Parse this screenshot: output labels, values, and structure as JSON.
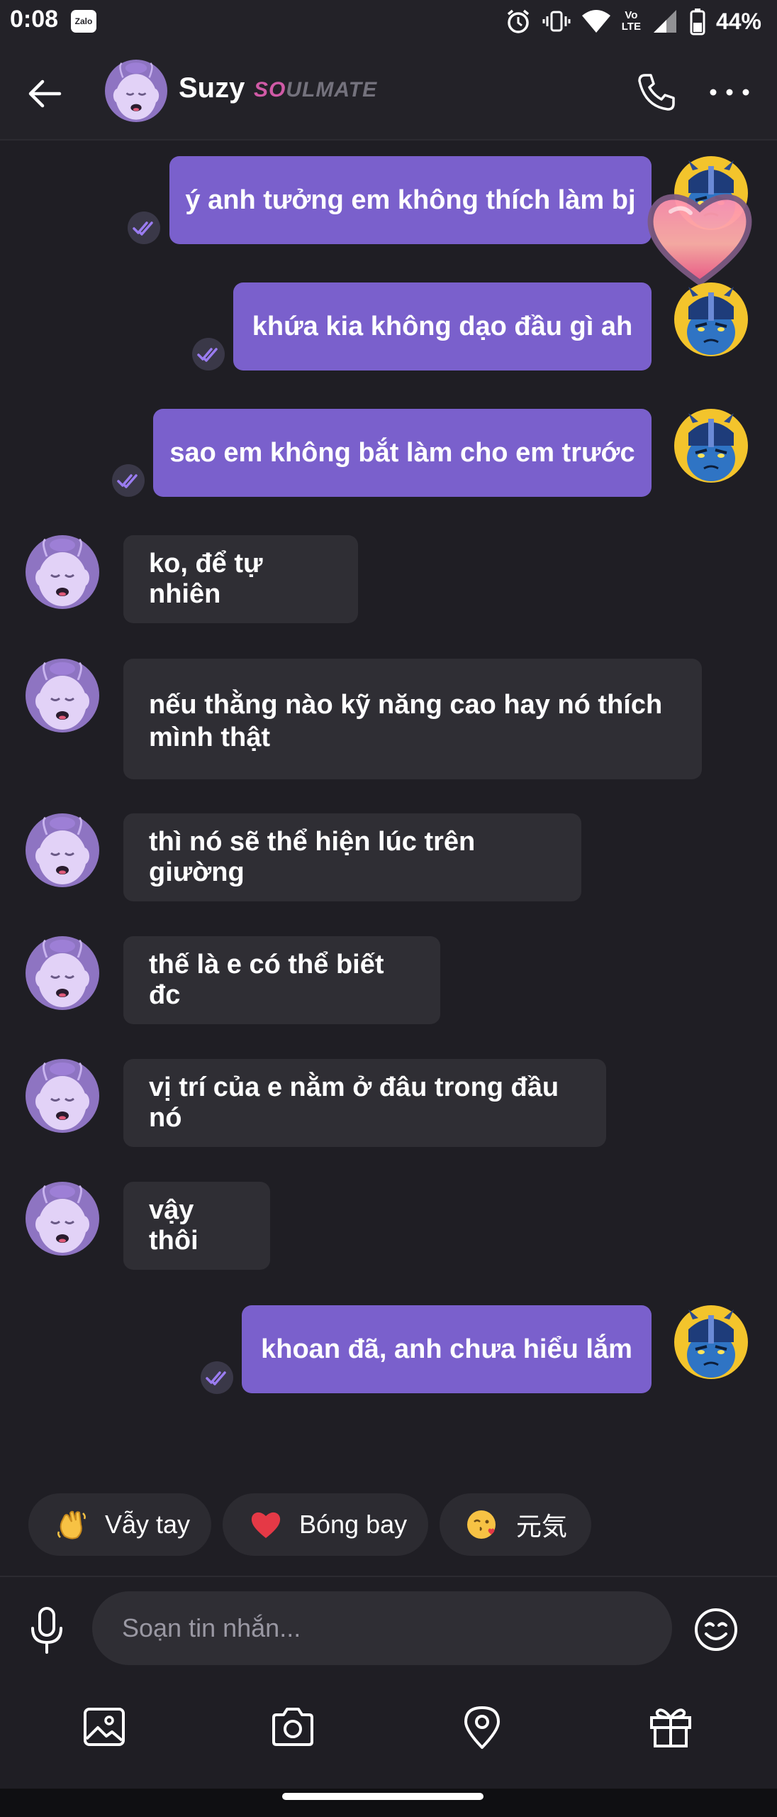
{
  "status_bar": {
    "time": "0:08",
    "zalo_label": "Zalo",
    "battery": "44%",
    "network_label_top": "Vo",
    "network_label_bottom": "LTE"
  },
  "header": {
    "name": "Suzy",
    "badge_prefix": "SO",
    "badge_suffix": "ULMATE"
  },
  "messages": [
    {
      "side": "out",
      "text": "ý anh tưởng em không thích làm bj"
    },
    {
      "side": "out",
      "text": "khứa kia không dạo đầu gì ah"
    },
    {
      "side": "out",
      "text": "sao em không bắt làm cho em trước"
    },
    {
      "side": "in",
      "text": "ko, để tự nhiên"
    },
    {
      "side": "in",
      "text": "nếu thằng nào kỹ năng cao hay nó thích mình thật"
    },
    {
      "side": "in",
      "text": "thì nó sẽ thể hiện lúc trên giường"
    },
    {
      "side": "in",
      "text": "thế là e có thể biết đc"
    },
    {
      "side": "in",
      "text": "vị trí của e nằm ở đâu trong đầu nó"
    },
    {
      "side": "in",
      "text": "vậy thôi"
    },
    {
      "side": "out",
      "text": "khoan đã, anh chưa hiểu lắm"
    }
  ],
  "quick_replies": [
    {
      "label": "Vẫy tay",
      "icon": "waving-hand"
    },
    {
      "label": "Bóng bay",
      "icon": "red-heart"
    },
    {
      "label": "元気",
      "icon": "winking-kiss-face"
    }
  ],
  "compose": {
    "placeholder": "Soạn tin nhắn..."
  },
  "toolbar": [
    "image-icon",
    "camera-icon",
    "location-icon",
    "gift-icon"
  ],
  "colors": {
    "background": "#1f1e24",
    "outgoing_bubble": "#7a60cc",
    "incoming_bubble": "#2f2e34",
    "accent_pink": "#d05aa6"
  }
}
